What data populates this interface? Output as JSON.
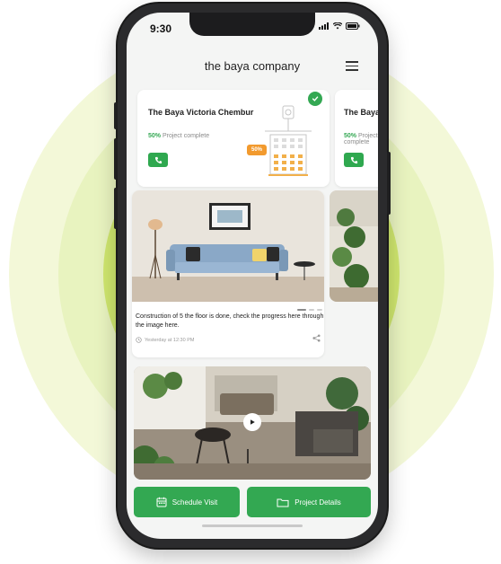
{
  "status_bar": {
    "time": "9:30"
  },
  "header": {
    "brand": "the baya company"
  },
  "projects": [
    {
      "title": "The Baya Victoria Chembur",
      "progress_percent_label": "50%",
      "progress_text": "Project complete",
      "badge_percent": "50%",
      "completed": true
    },
    {
      "title": "The Baya Versova",
      "progress_percent_label": "50%",
      "progress_text": "Project complete"
    }
  ],
  "update": {
    "text": "Construction of 5 the floor is done, check the progress here through the image here.",
    "timestamp": "Yesterday at 12:30 PM"
  },
  "actions": {
    "schedule_visit": "Schedule Visit",
    "project_details": "Project Details"
  },
  "colors": {
    "accent_green": "#33a852",
    "ring_outer": "#f3f8d8",
    "ring_mid": "#e6f2b4",
    "ring_inner": "#cfe66e",
    "badge_orange": "#f29a2e"
  },
  "icons": [
    "signal-icon",
    "wifi-icon",
    "battery-icon",
    "menu-icon",
    "check-icon",
    "phone-icon",
    "building-icon",
    "clock-icon",
    "share-icon",
    "play-icon",
    "calendar-icon",
    "folder-icon"
  ]
}
